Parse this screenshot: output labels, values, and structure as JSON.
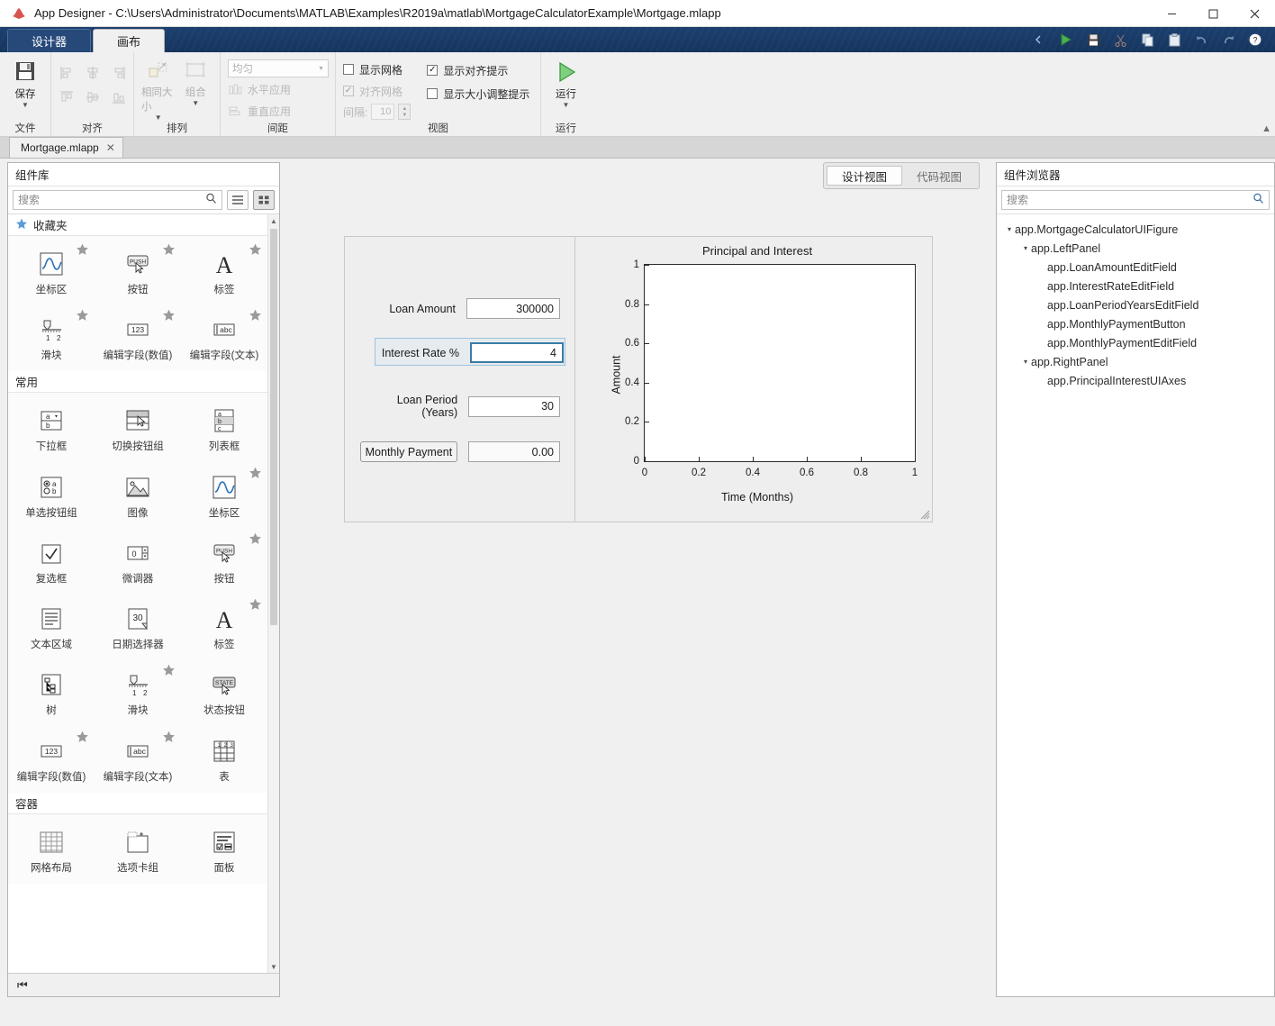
{
  "titlebar": {
    "title": "App Designer - C:\\Users\\Administrator\\Documents\\MATLAB\\Examples\\R2019a\\matlab\\MortgageCalculatorExample\\Mortgage.mlapp",
    "minimize": "─",
    "maximize": "☐",
    "close": "✕"
  },
  "ribbon": {
    "tabs": [
      {
        "label": "设计器"
      },
      {
        "label": "画布"
      }
    ],
    "quick_access": [
      {
        "name": "run-icon",
        "glyph": "▶"
      },
      {
        "name": "save-icon",
        "glyph": "Ὃe"
      },
      {
        "name": "cut-icon",
        "glyph": "✂"
      },
      {
        "name": "copy-icon",
        "glyph": "⧉"
      },
      {
        "name": "paste-icon",
        "glyph": "Ὄb"
      },
      {
        "name": "undo-icon",
        "glyph": "↶"
      },
      {
        "name": "redo-icon",
        "glyph": "↷"
      },
      {
        "name": "help-icon",
        "glyph": "?"
      }
    ],
    "groups": {
      "file": {
        "title": "文件",
        "save_label": "保存"
      },
      "align": {
        "title": "对齐"
      },
      "arrange": {
        "title": "排列",
        "same_size_label": "相同大小",
        "group_label": "组合"
      },
      "spacing": {
        "title": "间距",
        "mode_value": "均匀",
        "horizontal_label": "水平应用",
        "vertical_label": "重直应用"
      },
      "view": {
        "title": "视图",
        "show_grid": {
          "label": "显示网格",
          "checked": false,
          "disabled": false
        },
        "snap_grid": {
          "label": "对齐网格",
          "checked": true,
          "disabled": true
        },
        "show_align_hints": {
          "label": "显示对齐提示",
          "checked": true,
          "disabled": false
        },
        "show_resize_hints": {
          "label": "显示大小调整提示",
          "checked": false,
          "disabled": false
        },
        "interval_label": "间隔:",
        "interval_value": "10"
      },
      "run": {
        "title": "运行",
        "run_label": "运行"
      }
    },
    "collapse_glyph": "▲"
  },
  "doc_tabs": [
    {
      "label": "Mortgage.mlapp",
      "close_glyph": "✕"
    }
  ],
  "component_library": {
    "title": "组件库",
    "search_placeholder": "搜索",
    "search_value": "",
    "list_view_icon": "list-view-icon",
    "grid_view_icon": "grid-view-icon",
    "sections": [
      {
        "name": "favorites",
        "title": "收藏夹",
        "has_star_icon": true,
        "items": [
          {
            "label": "坐标区",
            "icon": "axes-icon",
            "starred": true
          },
          {
            "label": "按钮",
            "icon": "push-button-icon",
            "starred": true
          },
          {
            "label": "标签",
            "icon": "label-icon",
            "starred": true
          },
          {
            "label": "滑块",
            "icon": "slider-icon",
            "starred": true
          },
          {
            "label": "编辑字段(数值)",
            "icon": "numeric-edit-field-icon",
            "starred": true
          },
          {
            "label": "编辑字段(文本)",
            "icon": "text-edit-field-icon",
            "starred": true
          }
        ]
      },
      {
        "name": "common",
        "title": "常用",
        "has_star_icon": false,
        "items": [
          {
            "label": "下拉框",
            "icon": "dropdown-icon",
            "starred": false
          },
          {
            "label": "切换按钮组",
            "icon": "toggle-button-group-icon",
            "starred": false
          },
          {
            "label": "列表框",
            "icon": "listbox-icon",
            "starred": false
          },
          {
            "label": "单选按钮组",
            "icon": "radio-button-group-icon",
            "starred": false
          },
          {
            "label": "图像",
            "icon": "image-icon",
            "starred": false
          },
          {
            "label": "坐标区",
            "icon": "axes-icon",
            "starred": true
          },
          {
            "label": "复选框",
            "icon": "checkbox-icon",
            "starred": false
          },
          {
            "label": "微调器",
            "icon": "spinner-icon",
            "starred": false
          },
          {
            "label": "按钮",
            "icon": "push-button-icon",
            "starred": true
          },
          {
            "label": "文本区域",
            "icon": "text-area-icon",
            "starred": false
          },
          {
            "label": "日期选择器",
            "icon": "date-picker-icon",
            "starred": false
          },
          {
            "label": "标签",
            "icon": "label-icon",
            "starred": true
          },
          {
            "label": "树",
            "icon": "tree-icon",
            "starred": false
          },
          {
            "label": "滑块",
            "icon": "slider-icon",
            "starred": true
          },
          {
            "label": "状态按钮",
            "icon": "state-button-icon",
            "starred": false
          },
          {
            "label": "编辑字段(数值)",
            "icon": "numeric-edit-field-icon",
            "starred": true
          },
          {
            "label": "编辑字段(文本)",
            "icon": "text-edit-field-icon",
            "starred": true
          },
          {
            "label": "表",
            "icon": "table-icon",
            "starred": false
          }
        ]
      },
      {
        "name": "containers",
        "title": "容器",
        "has_star_icon": false,
        "items": [
          {
            "label": "网格布局",
            "icon": "grid-layout-icon",
            "starred": false
          },
          {
            "label": "选项卡组",
            "icon": "tab-group-icon",
            "starred": false
          },
          {
            "label": "面板",
            "icon": "panel-icon",
            "starred": false
          }
        ]
      }
    ],
    "collapse_glyph": "⏮"
  },
  "canvas": {
    "view_tabs": [
      {
        "label": "设计视图",
        "active": true
      },
      {
        "label": "代码视图",
        "active": false
      }
    ],
    "app": {
      "fields": [
        {
          "label": "Loan Amount",
          "value": "300000",
          "selected": false,
          "readonly": false
        },
        {
          "label": "Interest Rate %",
          "value": "4",
          "selected": true,
          "readonly": false
        },
        {
          "label": "Loan Period (Years)",
          "value": "30",
          "selected": false,
          "readonly": false
        }
      ],
      "button": {
        "label": "Monthly Payment"
      },
      "result": {
        "value": "0.00"
      }
    }
  },
  "chart_data": {
    "type": "line",
    "title": "Principal and Interest",
    "xlabel": "Time (Months)",
    "ylabel": "Amount",
    "xlim": [
      0,
      1
    ],
    "ylim": [
      0,
      1
    ],
    "xticks": [
      "0",
      "0.2",
      "0.4",
      "0.6",
      "0.8",
      "1"
    ],
    "yticks": [
      "0",
      "0.2",
      "0.4",
      "0.6",
      "0.8",
      "1"
    ],
    "xtick_values": [
      0,
      0.2,
      0.4,
      0.6,
      0.8,
      1
    ],
    "ytick_values": [
      0,
      0.2,
      0.4,
      0.6,
      0.8,
      1
    ],
    "grid": false,
    "legend": null,
    "series": []
  },
  "component_browser": {
    "title": "组件浏览器",
    "search_placeholder": "搜索",
    "search_value": "",
    "tree": [
      {
        "label": "app.MortgageCalculatorUIFigure",
        "depth": 0,
        "expandable": true,
        "caret": "▾"
      },
      {
        "label": "app.LeftPanel",
        "depth": 1,
        "expandable": true,
        "caret": "▾"
      },
      {
        "label": "app.LoanAmountEditField",
        "depth": 2,
        "expandable": false,
        "caret": ""
      },
      {
        "label": "app.InterestRateEditField",
        "depth": 2,
        "expandable": false,
        "caret": ""
      },
      {
        "label": "app.LoanPeriodYearsEditField",
        "depth": 2,
        "expandable": false,
        "caret": ""
      },
      {
        "label": "app.MonthlyPaymentButton",
        "depth": 2,
        "expandable": false,
        "caret": ""
      },
      {
        "label": "app.MonthlyPaymentEditField",
        "depth": 2,
        "expandable": false,
        "caret": ""
      },
      {
        "label": "app.RightPanel",
        "depth": 1,
        "expandable": true,
        "caret": "▾"
      },
      {
        "label": "app.PrincipalInterestUIAxes",
        "depth": 2,
        "expandable": false,
        "caret": ""
      }
    ]
  },
  "colors": {
    "ribbon_dark": "#1c3f6e",
    "selection_blue": "#3a7ca5",
    "panel_bg": "#f0f0f0",
    "star_gray": "#9a9a9a"
  }
}
